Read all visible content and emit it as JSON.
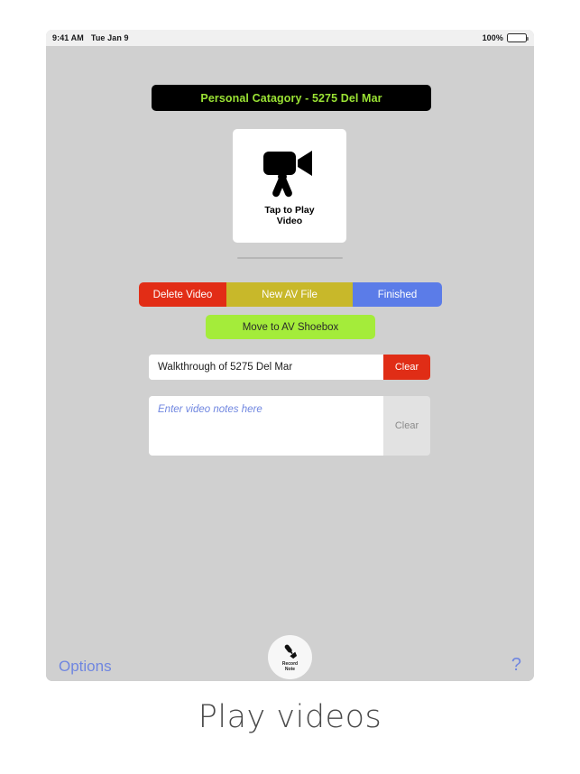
{
  "status_bar": {
    "time": "9:41 AM",
    "date": "Tue Jan 9",
    "battery_percent": "100%",
    "battery_icon": "battery-full-icon"
  },
  "header": {
    "title": "Personal Catagory - 5275 Del Mar",
    "title_color": "#9ae234",
    "background_color": "#000000"
  },
  "video_card": {
    "icon": "video-camera-icon",
    "label_line1": "Tap to Play",
    "label_line2": "Video"
  },
  "actions": {
    "delete_label": "Delete Video",
    "delete_color": "#e22d16",
    "new_label": "New AV File",
    "new_color": "#c8b82a",
    "finished_label": "Finished",
    "finished_color": "#5b7ce8",
    "shoebox_label": "Move to AV Shoebox",
    "shoebox_color": "#a4ec3a"
  },
  "title_field": {
    "value": "Walkthrough of 5275 Del Mar",
    "clear_label": "Clear"
  },
  "notes_field": {
    "value": "",
    "placeholder": "Enter video notes here",
    "clear_label": "Clear"
  },
  "record_note": {
    "icon": "microphone-icon",
    "label_line1": "Record",
    "label_line2": "Note"
  },
  "footer": {
    "options_label": "Options",
    "help_label": "?",
    "link_color": "#6f86e0"
  },
  "caption": {
    "text": "Play videos"
  }
}
